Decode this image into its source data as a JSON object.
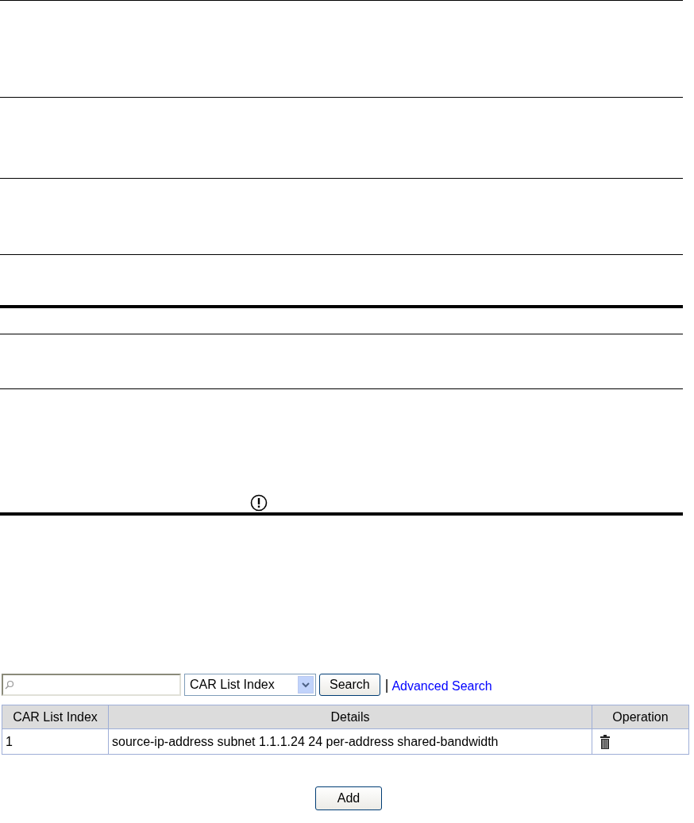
{
  "search": {
    "select_value": "CAR List Index",
    "button": "Search",
    "separator": "|",
    "link": "Advanced Search"
  },
  "table": {
    "columns": [
      "CAR List Index",
      "Details",
      "Operation"
    ],
    "rows": [
      {
        "index": "1",
        "details": "source-ip-address subnet 1.1.1.24 24 per-address shared-bandwidth"
      }
    ]
  },
  "add_button": "Add"
}
